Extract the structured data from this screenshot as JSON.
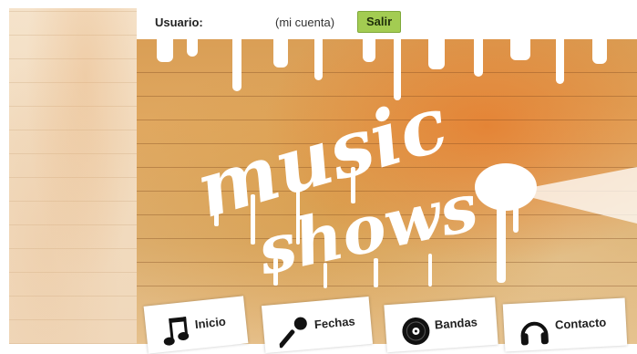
{
  "account": {
    "user_label": "Usuario:",
    "account_link": "(mi cuenta)",
    "logout_button": "Salir"
  },
  "logo": {
    "line1": "music",
    "line2": "shows"
  },
  "nav": {
    "items": [
      {
        "label": "Inicio",
        "icon": "music-note-icon"
      },
      {
        "label": "Fechas",
        "icon": "microphone-icon"
      },
      {
        "label": "Bandas",
        "icon": "vinyl-record-icon"
      },
      {
        "label": "Contacto",
        "icon": "headphones-icon"
      }
    ]
  },
  "colors": {
    "logout_button_bg": "#a3cc52",
    "wall_orange": "#dc9a50",
    "wall_light": "#f3dfc5"
  }
}
